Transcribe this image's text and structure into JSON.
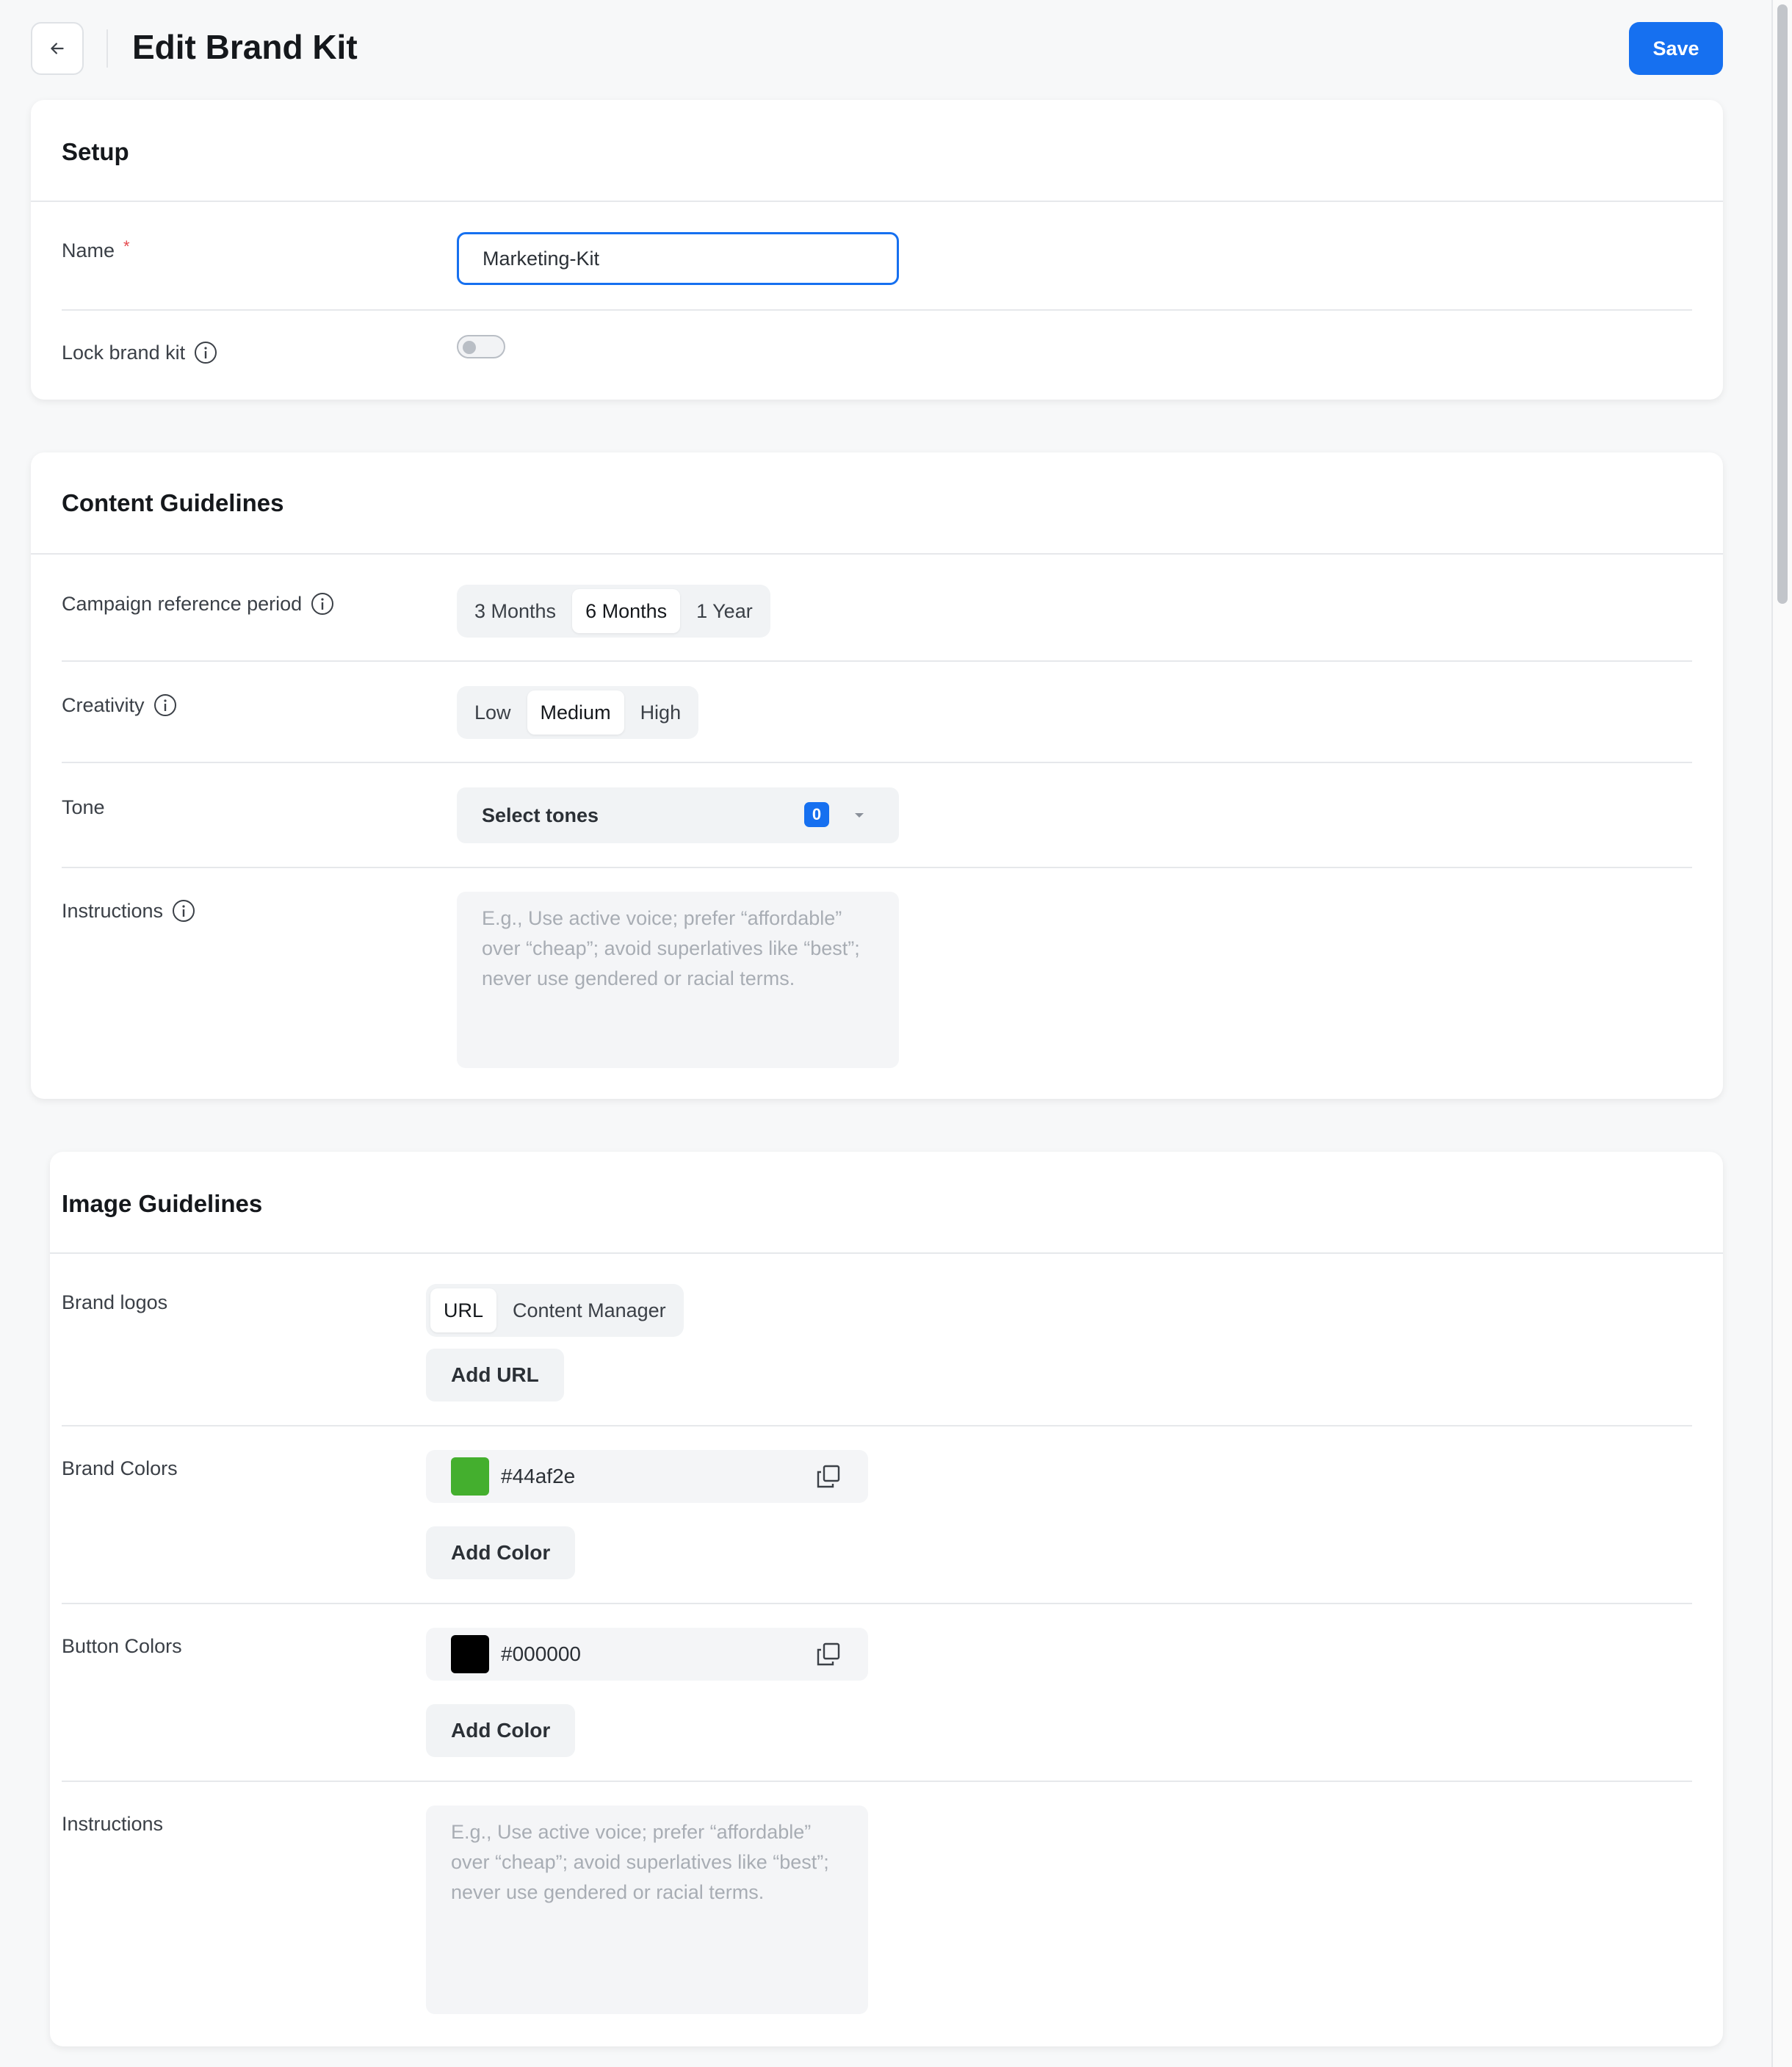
{
  "header": {
    "title": "Edit Brand Kit",
    "save_label": "Save"
  },
  "setup": {
    "title": "Setup",
    "name_label": "Name",
    "required_mark": "*",
    "name_value": "Marketing-Kit",
    "lock_label": "Lock brand kit",
    "lock_enabled": false
  },
  "content_guidelines": {
    "title": "Content Guidelines",
    "period_label": "Campaign reference period",
    "period_options": [
      "3 Months",
      "6 Months",
      "1 Year"
    ],
    "period_selected": "6 Months",
    "creativity_label": "Creativity",
    "creativity_options": [
      "Low",
      "Medium",
      "High"
    ],
    "creativity_selected": "Medium",
    "tone_label": "Tone",
    "tone_placeholder": "Select tones",
    "tone_count": "0",
    "instructions_label": "Instructions",
    "instructions_placeholder": "E.g., Use active voice; prefer “affordable” over “cheap”; avoid superlatives like “best”; never use gendered or racial terms."
  },
  "image_guidelines": {
    "title": "Image Guidelines",
    "logos_label": "Brand logos",
    "logo_source_options": [
      "URL",
      "Content Manager"
    ],
    "logo_source_selected": "URL",
    "add_url_label": "Add URL",
    "brand_colors_label": "Brand Colors",
    "brand_color_hex": "#44af2e",
    "add_color_label": "Add Color",
    "button_colors_label": "Button Colors",
    "button_color_hex": "#000000",
    "add_button_color_label": "Add Color",
    "instructions_label": "Instructions",
    "instructions_placeholder": "E.g., Use active voice; prefer “affordable” over “cheap”; avoid superlatives like “best”; never use gendered or racial terms."
  },
  "colors": {
    "accent": "#1670f0",
    "brand_swatch": "#44af2e",
    "button_swatch": "#000000"
  }
}
